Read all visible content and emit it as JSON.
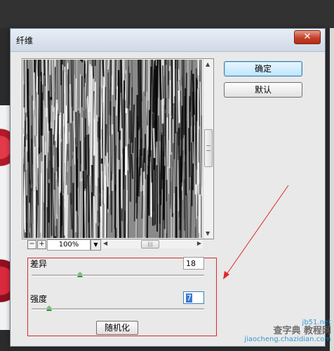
{
  "window": {
    "title": "纤维",
    "close_label": "✕"
  },
  "buttons": {
    "ok": "确定",
    "default": "默认",
    "randomize": "随机化"
  },
  "zoom": {
    "minus": "−",
    "plus": "+",
    "value": "100%"
  },
  "params": {
    "variance": {
      "label": "差异",
      "value": "18",
      "slider_fraction": 0.28
    },
    "strength": {
      "label": "强度",
      "value": "7",
      "slider_fraction": 0.1
    }
  },
  "watermark": {
    "line1": "jb51.net",
    "line2": "查字典 教程网",
    "line3": "jiaocheng.chazidian.com"
  },
  "colors": {
    "annotation_red": "#e0262a",
    "ok_button_blue": "#3c7fb1"
  }
}
